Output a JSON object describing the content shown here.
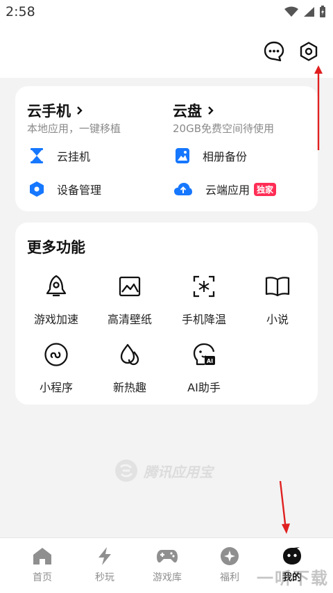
{
  "status": {
    "time": "2:58"
  },
  "card1": {
    "left": {
      "title": "云手机",
      "subtitle": "本地应用，一键移植"
    },
    "right": {
      "title": "云盘",
      "subtitle": "20GB免费空间待使用"
    },
    "items": [
      {
        "label": "云挂机"
      },
      {
        "label": "相册备份"
      },
      {
        "label": "设备管理"
      },
      {
        "label": "云端应用",
        "badge": "独家"
      }
    ]
  },
  "more": {
    "title": "更多功能",
    "features": [
      {
        "label": "游戏加速"
      },
      {
        "label": "高清壁纸"
      },
      {
        "label": "手机降温"
      },
      {
        "label": "小说"
      },
      {
        "label": "小程序"
      },
      {
        "label": "新热趣"
      },
      {
        "label": "AI助手"
      }
    ]
  },
  "watermark": "腾讯应用宝",
  "corner_watermark": "一听下载",
  "nav": [
    {
      "label": "首页"
    },
    {
      "label": "秒玩"
    },
    {
      "label": "游戏库"
    },
    {
      "label": "福利"
    },
    {
      "label": "我的"
    }
  ],
  "colors": {
    "accent": "#1677ff",
    "badge": "#ff2d55",
    "arrow": "#e02020"
  }
}
